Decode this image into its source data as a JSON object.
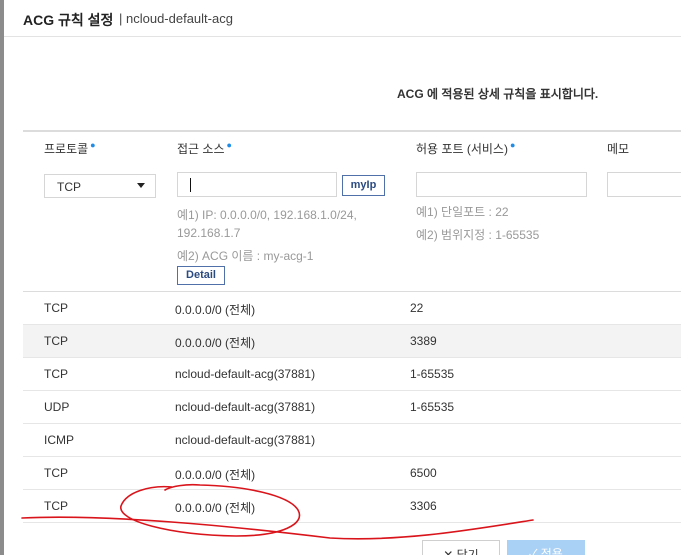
{
  "dialog": {
    "title": "ACG 규칙 설정",
    "subtitle": "| ncloud-default-acg",
    "description": "ACG 에 적용된 상세 규칙을 표시합니다."
  },
  "columns": {
    "protocol": "프로토콜",
    "source": "접근 소스",
    "port": "허용 포트 (서비스)",
    "memo": "메모",
    "required_mark": "●"
  },
  "form": {
    "protocol_value": "TCP",
    "myip_label": "myIp",
    "source_hint_1": "예1) IP: 0.0.0.0/0, 192.168.1.0/24,",
    "source_hint_1b": "192.168.1.7",
    "source_hint_2": "예2) ACG 이름 : my-acg-1",
    "detail_label": "Detail",
    "port_hint_1": "예1) 단일포트 : 22",
    "port_hint_2": "예2) 범위지정 : 1-65535"
  },
  "rules": [
    {
      "protocol": "TCP",
      "source": "0.0.0.0/0 (전체)",
      "port": "22"
    },
    {
      "protocol": "TCP",
      "source": "0.0.0.0/0 (전체)",
      "port": "3389"
    },
    {
      "protocol": "TCP",
      "source": "ncloud-default-acg(37881)",
      "port": "1-65535"
    },
    {
      "protocol": "UDP",
      "source": "ncloud-default-acg(37881)",
      "port": "1-65535"
    },
    {
      "protocol": "ICMP",
      "source": "ncloud-default-acg(37881)",
      "port": ""
    },
    {
      "protocol": "TCP",
      "source": "0.0.0.0/0 (전체)",
      "port": "6500"
    },
    {
      "protocol": "TCP",
      "source": "0.0.0.0/0 (전체)",
      "port": "3306"
    }
  ],
  "footer": {
    "close_label": "✕  닫기",
    "apply_label": "✓  적용"
  },
  "colors": {
    "accent": "#1f8ce6",
    "annotation": "#d9141b",
    "apply_button": "#a9d0f5"
  }
}
